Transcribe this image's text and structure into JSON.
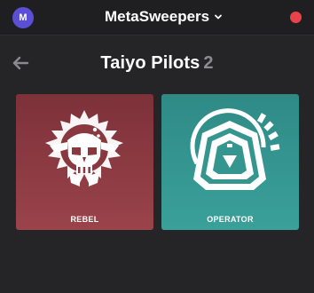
{
  "topbar": {
    "avatar_initial": "M",
    "workspace_name": "MetaSweepers",
    "workspace_icon": "chevron-down-icon",
    "status_color": "#e8434a"
  },
  "header": {
    "back_icon": "arrow-left-icon",
    "title": "Taiyo Pilots",
    "count": "2"
  },
  "pilots": [
    {
      "label": "REBEL",
      "emblem": "skull-gear-emblem",
      "color": "#8c3a42"
    },
    {
      "label": "OPERATOR",
      "emblem": "triangle-shield-emblem",
      "color": "#35958f"
    }
  ]
}
